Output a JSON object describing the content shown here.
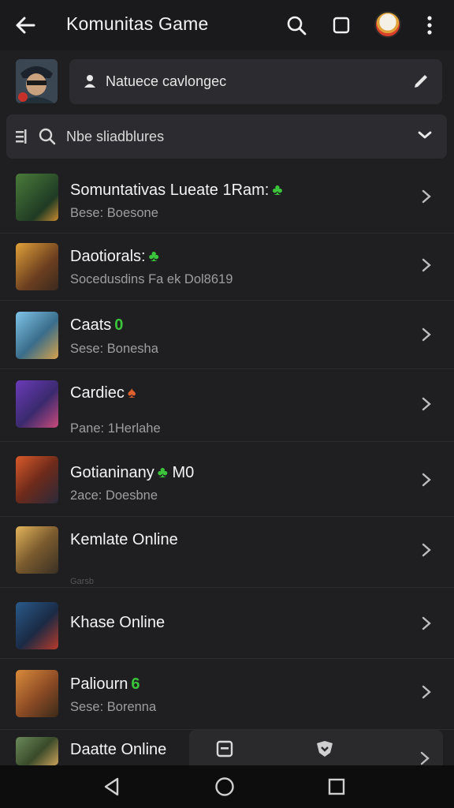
{
  "header": {
    "title": "Komunitas Game"
  },
  "composer": {
    "text": "Natuece cavlongec"
  },
  "search": {
    "text": "Nbe sliadblures"
  },
  "games": [
    {
      "name": "Somuntativas Lueate 1Ram:",
      "badge": "",
      "badge_color": "green",
      "sub": "Bese: Boesone"
    },
    {
      "name": "Daotiorals:",
      "badge": "",
      "badge_color": "green",
      "sub": "Socedusdins Fa ek Dol8619"
    },
    {
      "name": "Caats",
      "badge": "0",
      "badge_color": "green",
      "sub": "Sese: Bonesha"
    },
    {
      "name": "Cardiec",
      "badge": "",
      "badge_color": "orange",
      "sub": "Pane: 1Herlahe"
    },
    {
      "name": "Gotianinany",
      "badge": "M0",
      "badge_color": "green",
      "sub": "2ace: Doesbne"
    },
    {
      "name": "Kemlate Online",
      "badge": "",
      "badge_color": "",
      "sub": "Garsb"
    },
    {
      "name": "Khase Online",
      "badge": "",
      "badge_color": "",
      "sub": ""
    },
    {
      "name": "Paliourn",
      "badge": "6",
      "badge_color": "green",
      "sub": "Sese: Borenna"
    },
    {
      "name": "Daatte Online",
      "badge": "",
      "badge_color": "",
      "sub": ""
    }
  ],
  "colors": {
    "accent_green": "#3bc43b",
    "accent_orange": "#e0612f",
    "background": "#1f1f21"
  },
  "icons": {
    "back": "arrow-left-icon",
    "search": "search-icon",
    "square": "square-icon",
    "more": "more-vert-icon",
    "edit": "pencil-icon",
    "chevron": "chevron-right-icon"
  }
}
